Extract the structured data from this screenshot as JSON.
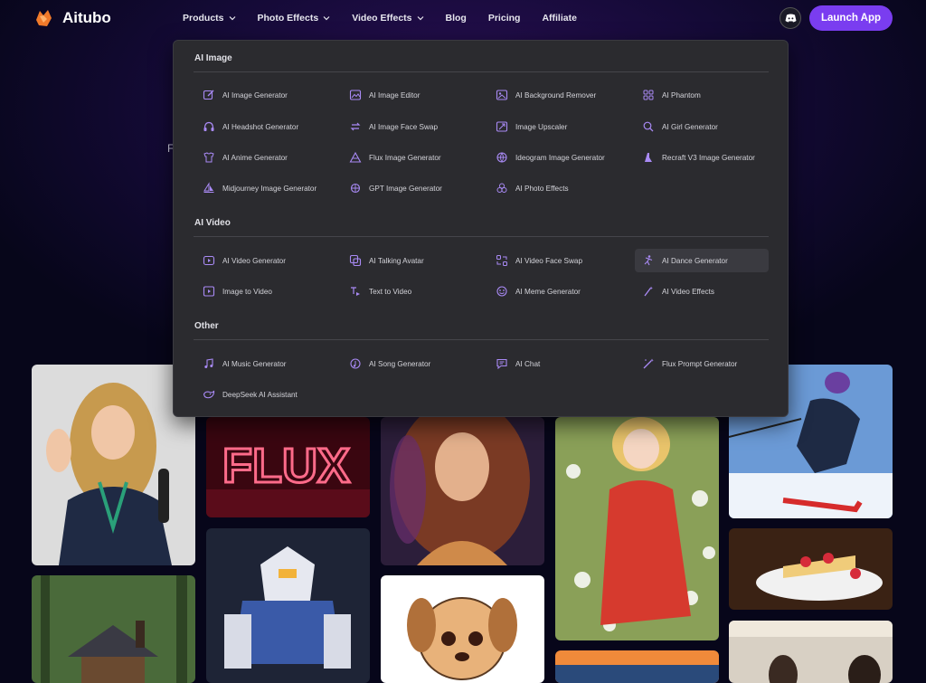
{
  "header": {
    "brand": "Aitubo",
    "nav": [
      "Products",
      "Photo Effects",
      "Video Effects",
      "Blog",
      "Pricing",
      "Affiliate"
    ],
    "launch_button": "Launch App"
  },
  "hero": {
    "partial_char": "F"
  },
  "menu": {
    "sections": [
      {
        "title": "AI Image",
        "items": [
          {
            "label": "AI Image Generator",
            "icon": "pencil-edit-icon"
          },
          {
            "label": "AI Image Editor",
            "icon": "image-edit-icon"
          },
          {
            "label": "AI Background Remover",
            "icon": "image-remove-icon"
          },
          {
            "label": "AI Phantom",
            "icon": "grid-icon"
          },
          {
            "label": "AI Headshot Generator",
            "icon": "headphones-icon"
          },
          {
            "label": "AI Image Face Swap",
            "icon": "swap-icon"
          },
          {
            "label": "Image Upscaler",
            "icon": "image-upscale-icon"
          },
          {
            "label": "AI Girl Generator",
            "icon": "search-icon"
          },
          {
            "label": "AI Anime Generator",
            "icon": "shirt-icon"
          },
          {
            "label": "Flux Image Generator",
            "icon": "triangle-icon"
          },
          {
            "label": "Ideogram Image Generator",
            "icon": "globe-icon"
          },
          {
            "label": "Recraft V3 Image Generator",
            "icon": "recraft-icon"
          },
          {
            "label": "Midjourney Image Generator",
            "icon": "sail-icon"
          },
          {
            "label": "GPT Image Generator",
            "icon": "spark-icon"
          },
          {
            "label": "AI Photo Effects",
            "icon": "effects-icon"
          }
        ]
      },
      {
        "title": "AI Video",
        "items": [
          {
            "label": "AI Video Generator",
            "icon": "play-icon"
          },
          {
            "label": "AI Talking Avatar",
            "icon": "avatar-icon"
          },
          {
            "label": "AI Video Face Swap",
            "icon": "face-swap-icon"
          },
          {
            "label": "AI Dance Generator",
            "icon": "dance-icon"
          },
          {
            "label": "Image to Video",
            "icon": "image-video-icon"
          },
          {
            "label": "Text to Video",
            "icon": "text-video-icon"
          },
          {
            "label": "AI Meme Generator",
            "icon": "meme-icon"
          },
          {
            "label": "AI Video Effects",
            "icon": "wand-icon"
          }
        ]
      },
      {
        "title": "Other",
        "items": [
          {
            "label": "AI Music Generator",
            "icon": "music-icon"
          },
          {
            "label": "AI Song Generator",
            "icon": "song-icon"
          },
          {
            "label": "AI Chat",
            "icon": "chat-icon"
          },
          {
            "label": "Flux Prompt Generator",
            "icon": "magic-icon"
          },
          {
            "label": "DeepSeek AI Assistant",
            "icon": "whale-icon"
          }
        ]
      }
    ],
    "active_item": "AI Dance Generator"
  },
  "gallery": {
    "neon_text": "FLUX",
    "tiles": [
      "woman-with-microphone",
      "neon-flux-sign",
      "wavy-hair-portrait",
      "anime-girl-flowers",
      "skier",
      "gundam-robot",
      "cheesecake",
      "forest-cabin",
      "cartoon-puppy",
      "sunset-sea",
      "cafe-people"
    ]
  },
  "colors": {
    "accent": "#7a3df0",
    "menu_bg": "#2b2b2f",
    "icon": "#a98af5"
  }
}
